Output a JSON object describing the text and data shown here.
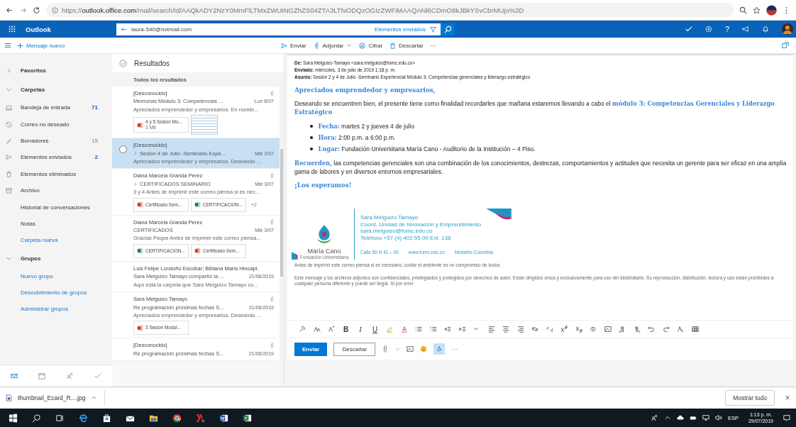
{
  "browser": {
    "url": "https://**outlook.office.com**/mail/search/id/AAQkADY2NzY0MmFlLTMxZWUtNGZhZS04ZTA3LThiODQzOGIzZWFiMAAQANl6CDmO8kJBkYSvCbrMUjo%3D"
  },
  "header": {
    "app": "Outlook",
    "search_value": "laura-540@hotmail.com",
    "search_scope": "Elementos enviados",
    "help": "?"
  },
  "commands": {
    "new_message": "Mensaje nuevo",
    "actions": [
      "Enviar",
      "Adjuntar",
      "Cifrar",
      "Descartar"
    ],
    "more": "···"
  },
  "nav": [
    {
      "kind": "section",
      "label": "Favoritos",
      "expanded": false
    },
    {
      "kind": "section",
      "label": "Carpetas",
      "expanded": true
    },
    {
      "kind": "folder",
      "label": "Bandeja de entrada",
      "count": "71",
      "unread": true
    },
    {
      "kind": "folder",
      "label": "Correo no deseado"
    },
    {
      "kind": "folder",
      "label": "Borradores",
      "count": "15",
      "unread": false
    },
    {
      "kind": "folder",
      "label": "Elementos enviados",
      "count": "2",
      "unread": true
    },
    {
      "kind": "folder",
      "label": "Elementos eliminados"
    },
    {
      "kind": "folder",
      "label": "Archivo"
    },
    {
      "kind": "plain",
      "label": "Historial de conversaciones"
    },
    {
      "kind": "plain",
      "label": "Notas"
    },
    {
      "kind": "link",
      "label": "Carpeta nueva"
    },
    {
      "kind": "section",
      "label": "Grupos",
      "expanded": true
    },
    {
      "kind": "link",
      "label": "Nuevo grupo"
    },
    {
      "kind": "link",
      "label": "Descubrimiento de grupos"
    },
    {
      "kind": "link",
      "label": "Administrar grupos"
    }
  ],
  "list": {
    "title": "Resultados",
    "filter": "Todos los resultados",
    "messages": [
      {
        "sender": "[Desconocido]",
        "subject": "Memorias Módulo 3: Competencias ...",
        "date": "Lun 8/07",
        "preview": "Apreciados emprendedor y empresarios. En nombr...",
        "attachment": true,
        "thread": false,
        "selected": false,
        "files": [
          {
            "kind": "ppt",
            "name": "4 y 5 Sesion Mo...",
            "size": "3 MB"
          },
          {
            "kind": "image"
          }
        ]
      },
      {
        "sender": "[Desconocido]",
        "subject": "Sesión 4 de Julio -Seminario Expe...",
        "date": "Mié 3/07",
        "preview": "Apreciados emprendedor y empresarios. Deseando ...",
        "attachment": false,
        "thread": true,
        "selected": true
      },
      {
        "sender": "Diana Marcela Granda Perez",
        "subject": "CERTIFICADOS SEMINARIO",
        "date": "Mié 3/07",
        "preview": "3 y 4 Antes de imprimir este correo piensa si es nec...",
        "attachment": true,
        "thread": true,
        "selected": false,
        "files": [
          {
            "kind": "ppt",
            "name": "Certificado Sem..."
          },
          {
            "kind": "excel",
            "name": "CERTIFICACION..."
          }
        ],
        "more": "+2"
      },
      {
        "sender": "Diana Marcela Granda Perez",
        "subject": "CERTIFICADOS",
        "date": "Mié 3/07",
        "preview": "Gracias Peque Antes de imprimir este correo piensa...",
        "attachment": true,
        "thread": false,
        "selected": false,
        "files": [
          {
            "kind": "excel",
            "name": "CERTIFICACION..."
          },
          {
            "kind": "ppt",
            "name": "Certificado Sem..."
          }
        ]
      },
      {
        "sender": "Luis Felipe Londoño Escobar; Bibiana Maria Hincapi.",
        "subject": "Sara Melguizo Tamayo compartió la ...",
        "date": "21/06/2019",
        "preview": "Aquí está la carpeta que Sara Melguizo Tamayo co...",
        "attachment": false,
        "thread": false,
        "selected": false
      },
      {
        "sender": "Sara Melguizo Tamayo",
        "subject": "Re programación próximas fechas S...",
        "date": "21/06/2019",
        "preview": "Apreciados emprendedor y empresarios. Deseando ...",
        "attachment": true,
        "thread": false,
        "selected": false,
        "files": [
          {
            "kind": "ppt",
            "name": "3 Sesion Modul..."
          }
        ]
      },
      {
        "sender": "[Desconocido]",
        "subject": "Re programación próximas fechas S...",
        "date": "21/06/2019",
        "attachment": true,
        "thread": false,
        "selected": false
      }
    ]
  },
  "email": {
    "meta": [
      "**De:** Sara Melguizo Tamayo <sara.melguizo@fumc.edu.co>",
      "**Enviado:** miércoles, 3 de julio de 2019 1:18 p. m.",
      "**Asunto:** Sesión 2 y 4 de Julio -Seminario Experiencial Módulo 3: Competencias gerenciales y liderazgo estratégico"
    ],
    "greeting": "Apreciados emprendedor y empresarios,",
    "intro": "Deseando se encuentren bien, el presente tiene como finalidad recordarles que mañana estaremos llevando a cabo el **módulo 3: Competencias Gerenciales y Liderazgo Estratégico**",
    "bullets": [
      "**Fecha:** martes 2 y jueves 4 de julio",
      "**Hora:** 2:00 p.m. a 6:00 p.m.",
      "**Lugar:** Fundación Universitaria María Cano -  Auditorio de la Institución – 4 Piso."
    ],
    "reminder": "**Recuerden,** las competencias gerenciales son una combinación de los conocimientos, destrezas, comportamientos y actitudes que necesita un gerente para ser eficaz en una amplia gama de labores y en diversos entornos empresariales.",
    "closing": "¡Los esperamos!",
    "signature": {
      "logo_name": "María Cano",
      "logo_sub": "Fundación Universitaria",
      "lines": [
        "Sara Melguizo  Tamayo",
        "Coord. Unidad de Innovación  y Emprendimiento",
        "sara.melguizo@fumc.edu.co",
        "Teléfono +57 (4) 402 55 00 Ext. 138"
      ],
      "address": [
        "Calle 56 N 41 – 90",
        "www.fumc.edu.co",
        "Medellín-Colombia"
      ]
    },
    "eco_note": "Antes de imprimir este correo piensa si es necesario, cuidar el ambiente es un compromiso de todos.",
    "disclaimer": "Este mensaje y los archivos adjuntos son confidenciales, privilegiados y protegidos por derechos de autor. Están dirigidos única y exclusivamente para uso del destinatario. Su reproducción, distribución, lectura y uso están prohibidos a cualquier persona diferente y puede ser ilegal. Si por error"
  },
  "compose": {
    "format_letters": [
      "B",
      "I",
      "U"
    ],
    "send": "Enviar",
    "discard": "Descartar",
    "more": "···"
  },
  "downloads": {
    "file": "thumbnail_Ecard_R....jpg",
    "show_all": "Mostrar todo",
    "close": "×"
  },
  "taskbar": {
    "language": "ESP",
    "time": "1:13 p. m.",
    "date": "29/07/2019"
  }
}
